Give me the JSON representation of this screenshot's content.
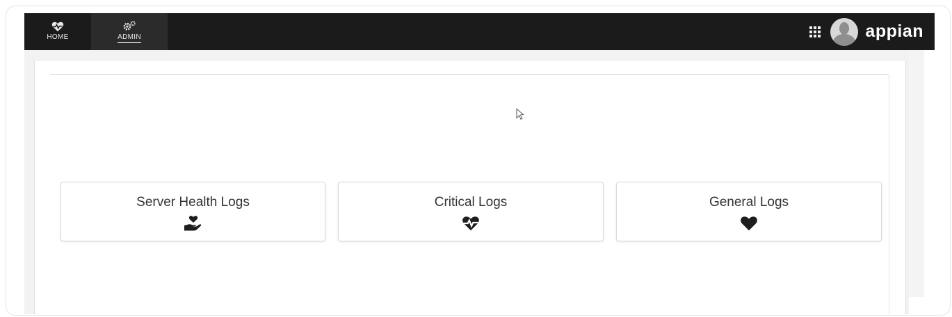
{
  "nav": {
    "tabs": [
      {
        "label": "HOME",
        "icon": "heartbeat-icon",
        "active": false
      },
      {
        "label": "ADMIN",
        "icon": "cogs-icon",
        "active": true
      }
    ]
  },
  "header": {
    "apps_icon": "grid-icon",
    "avatar_icon": "user-avatar",
    "logo_text": "appian"
  },
  "cards": [
    {
      "label": "Server Health Logs",
      "icon": "hand-holding-heart-icon"
    },
    {
      "label": "Critical Logs",
      "icon": "heartbeat-icon"
    },
    {
      "label": "General Logs",
      "icon": "heart-icon"
    }
  ],
  "colors": {
    "topbar": "#1b1b1b",
    "active_tab": "#2b2b2b",
    "card_text": "#333333",
    "icon": "#1e1e1e"
  }
}
